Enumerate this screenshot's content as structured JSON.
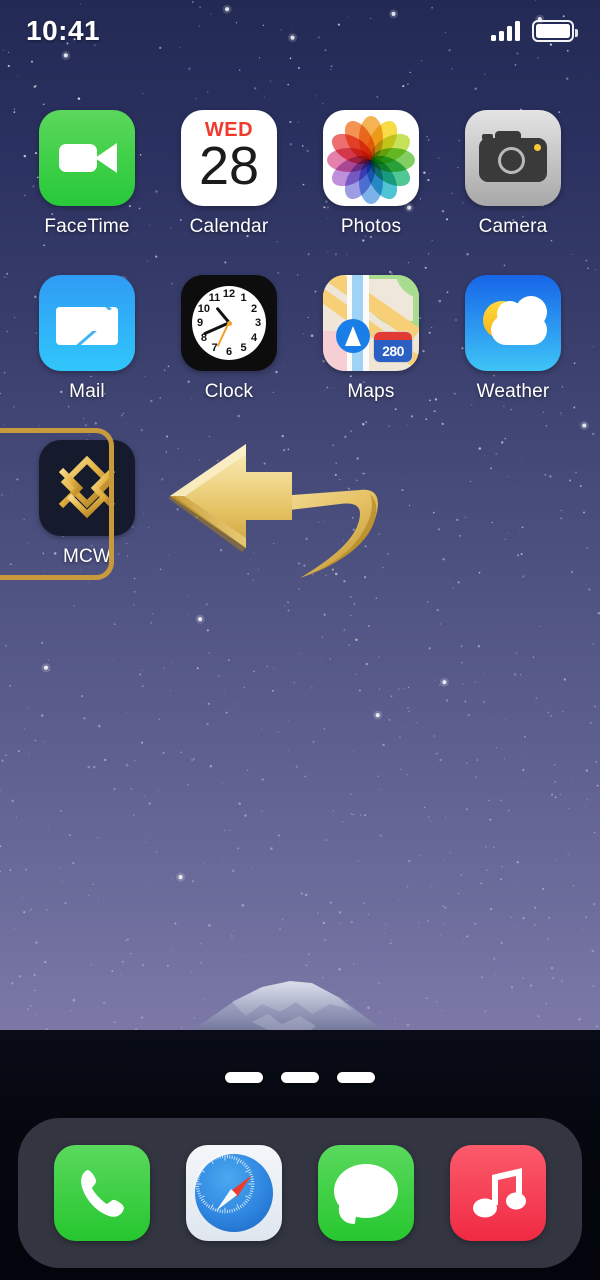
{
  "status_bar": {
    "time": "10:41",
    "signal_icon": "cellular-signal-icon",
    "battery_icon": "battery-full-icon"
  },
  "home_screen": {
    "rows": [
      [
        {
          "label": "FaceTime",
          "icon": "facetime-icon"
        },
        {
          "label": "Calendar",
          "icon": "calendar-icon",
          "dow": "WED",
          "day": "28"
        },
        {
          "label": "Photos",
          "icon": "photos-icon"
        },
        {
          "label": "Camera",
          "icon": "camera-icon"
        }
      ],
      [
        {
          "label": "Mail",
          "icon": "mail-icon"
        },
        {
          "label": "Clock",
          "icon": "clock-icon"
        },
        {
          "label": "Maps",
          "icon": "maps-icon",
          "highway": "280"
        },
        {
          "label": "Weather",
          "icon": "weather-icon"
        }
      ],
      [
        {
          "label": "MCW",
          "icon": "mcw-icon",
          "highlighted": true
        }
      ]
    ],
    "page_indicator": {
      "count": 3,
      "active": 1
    }
  },
  "annotation": {
    "arrow": "gold-curved-arrow-pointing-left",
    "highlight": "gold-rounded-rectangle-highlight",
    "highlight_color": "#c99a3c"
  },
  "dock": {
    "items": [
      {
        "label": "Phone",
        "icon": "phone-icon"
      },
      {
        "label": "Safari",
        "icon": "safari-icon"
      },
      {
        "label": "Messages",
        "icon": "messages-icon"
      },
      {
        "label": "Music",
        "icon": "music-icon"
      }
    ]
  },
  "wallpaper": {
    "description": "Mount Fuji under starry night sky",
    "sky_top_color": "#222a54",
    "sky_bottom_color": "#7e7aa8",
    "ground_color": "#05070f"
  }
}
